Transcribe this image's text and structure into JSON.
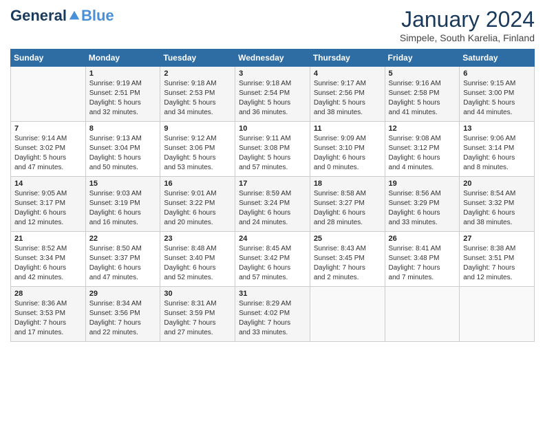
{
  "header": {
    "logo_general": "General",
    "logo_blue": "Blue",
    "month_title": "January 2024",
    "subtitle": "Simpele, South Karelia, Finland"
  },
  "days_of_week": [
    "Sunday",
    "Monday",
    "Tuesday",
    "Wednesday",
    "Thursday",
    "Friday",
    "Saturday"
  ],
  "weeks": [
    [
      {
        "day": "",
        "info": ""
      },
      {
        "day": "1",
        "info": "Sunrise: 9:19 AM\nSunset: 2:51 PM\nDaylight: 5 hours\nand 32 minutes."
      },
      {
        "day": "2",
        "info": "Sunrise: 9:18 AM\nSunset: 2:53 PM\nDaylight: 5 hours\nand 34 minutes."
      },
      {
        "day": "3",
        "info": "Sunrise: 9:18 AM\nSunset: 2:54 PM\nDaylight: 5 hours\nand 36 minutes."
      },
      {
        "day": "4",
        "info": "Sunrise: 9:17 AM\nSunset: 2:56 PM\nDaylight: 5 hours\nand 38 minutes."
      },
      {
        "day": "5",
        "info": "Sunrise: 9:16 AM\nSunset: 2:58 PM\nDaylight: 5 hours\nand 41 minutes."
      },
      {
        "day": "6",
        "info": "Sunrise: 9:15 AM\nSunset: 3:00 PM\nDaylight: 5 hours\nand 44 minutes."
      }
    ],
    [
      {
        "day": "7",
        "info": "Sunrise: 9:14 AM\nSunset: 3:02 PM\nDaylight: 5 hours\nand 47 minutes."
      },
      {
        "day": "8",
        "info": "Sunrise: 9:13 AM\nSunset: 3:04 PM\nDaylight: 5 hours\nand 50 minutes."
      },
      {
        "day": "9",
        "info": "Sunrise: 9:12 AM\nSunset: 3:06 PM\nDaylight: 5 hours\nand 53 minutes."
      },
      {
        "day": "10",
        "info": "Sunrise: 9:11 AM\nSunset: 3:08 PM\nDaylight: 5 hours\nand 57 minutes."
      },
      {
        "day": "11",
        "info": "Sunrise: 9:09 AM\nSunset: 3:10 PM\nDaylight: 6 hours\nand 0 minutes."
      },
      {
        "day": "12",
        "info": "Sunrise: 9:08 AM\nSunset: 3:12 PM\nDaylight: 6 hours\nand 4 minutes."
      },
      {
        "day": "13",
        "info": "Sunrise: 9:06 AM\nSunset: 3:14 PM\nDaylight: 6 hours\nand 8 minutes."
      }
    ],
    [
      {
        "day": "14",
        "info": "Sunrise: 9:05 AM\nSunset: 3:17 PM\nDaylight: 6 hours\nand 12 minutes."
      },
      {
        "day": "15",
        "info": "Sunrise: 9:03 AM\nSunset: 3:19 PM\nDaylight: 6 hours\nand 16 minutes."
      },
      {
        "day": "16",
        "info": "Sunrise: 9:01 AM\nSunset: 3:22 PM\nDaylight: 6 hours\nand 20 minutes."
      },
      {
        "day": "17",
        "info": "Sunrise: 8:59 AM\nSunset: 3:24 PM\nDaylight: 6 hours\nand 24 minutes."
      },
      {
        "day": "18",
        "info": "Sunrise: 8:58 AM\nSunset: 3:27 PM\nDaylight: 6 hours\nand 28 minutes."
      },
      {
        "day": "19",
        "info": "Sunrise: 8:56 AM\nSunset: 3:29 PM\nDaylight: 6 hours\nand 33 minutes."
      },
      {
        "day": "20",
        "info": "Sunrise: 8:54 AM\nSunset: 3:32 PM\nDaylight: 6 hours\nand 38 minutes."
      }
    ],
    [
      {
        "day": "21",
        "info": "Sunrise: 8:52 AM\nSunset: 3:34 PM\nDaylight: 6 hours\nand 42 minutes."
      },
      {
        "day": "22",
        "info": "Sunrise: 8:50 AM\nSunset: 3:37 PM\nDaylight: 6 hours\nand 47 minutes."
      },
      {
        "day": "23",
        "info": "Sunrise: 8:48 AM\nSunset: 3:40 PM\nDaylight: 6 hours\nand 52 minutes."
      },
      {
        "day": "24",
        "info": "Sunrise: 8:45 AM\nSunset: 3:42 PM\nDaylight: 6 hours\nand 57 minutes."
      },
      {
        "day": "25",
        "info": "Sunrise: 8:43 AM\nSunset: 3:45 PM\nDaylight: 7 hours\nand 2 minutes."
      },
      {
        "day": "26",
        "info": "Sunrise: 8:41 AM\nSunset: 3:48 PM\nDaylight: 7 hours\nand 7 minutes."
      },
      {
        "day": "27",
        "info": "Sunrise: 8:38 AM\nSunset: 3:51 PM\nDaylight: 7 hours\nand 12 minutes."
      }
    ],
    [
      {
        "day": "28",
        "info": "Sunrise: 8:36 AM\nSunset: 3:53 PM\nDaylight: 7 hours\nand 17 minutes."
      },
      {
        "day": "29",
        "info": "Sunrise: 8:34 AM\nSunset: 3:56 PM\nDaylight: 7 hours\nand 22 minutes."
      },
      {
        "day": "30",
        "info": "Sunrise: 8:31 AM\nSunset: 3:59 PM\nDaylight: 7 hours\nand 27 minutes."
      },
      {
        "day": "31",
        "info": "Sunrise: 8:29 AM\nSunset: 4:02 PM\nDaylight: 7 hours\nand 33 minutes."
      },
      {
        "day": "",
        "info": ""
      },
      {
        "day": "",
        "info": ""
      },
      {
        "day": "",
        "info": ""
      }
    ]
  ]
}
